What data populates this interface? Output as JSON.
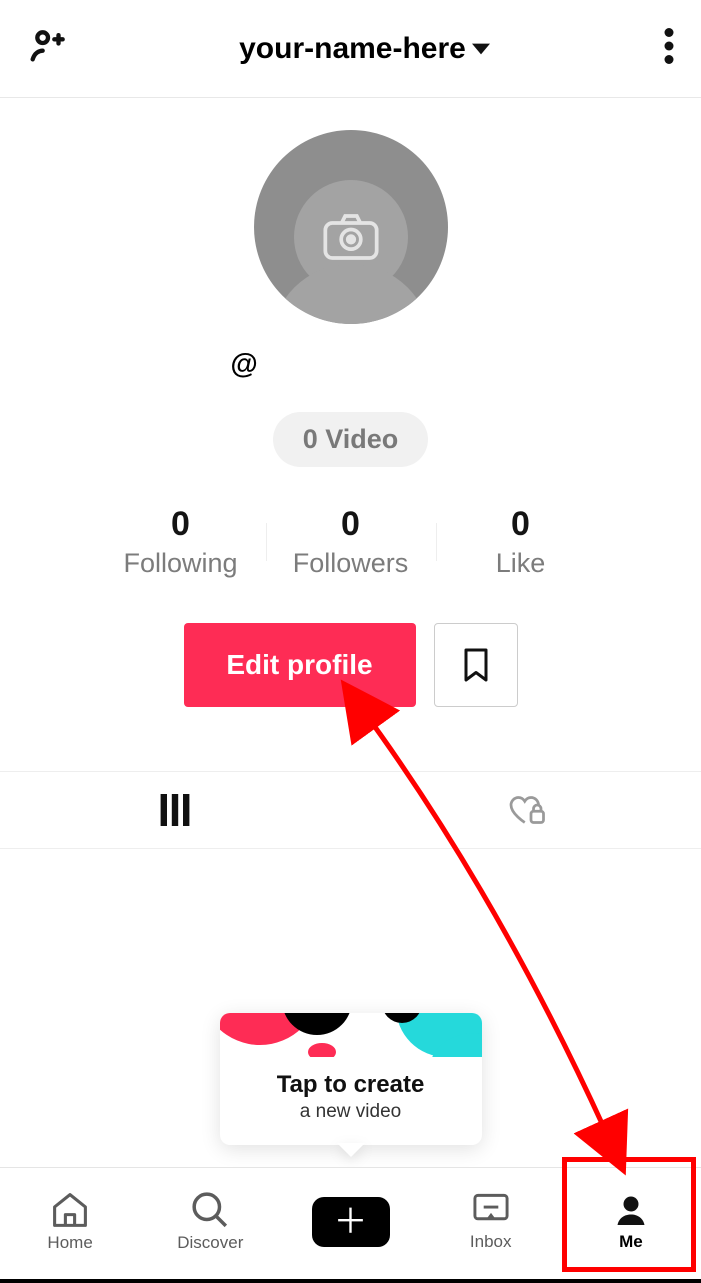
{
  "header": {
    "username_display": "your-name-here"
  },
  "profile": {
    "handle_prefix": "@",
    "video_count_label": "0 Video"
  },
  "stats": {
    "following": {
      "count": "0",
      "label": "Following"
    },
    "followers": {
      "count": "0",
      "label": "Followers"
    },
    "like": {
      "count": "0",
      "label": "Like"
    }
  },
  "buttons": {
    "edit_profile": "Edit profile"
  },
  "create_prompt": {
    "title": "Tap to create",
    "subtitle": "a new video"
  },
  "nav": {
    "home": "Home",
    "discover": "Discover",
    "inbox": "Inbox",
    "me": "Me"
  }
}
